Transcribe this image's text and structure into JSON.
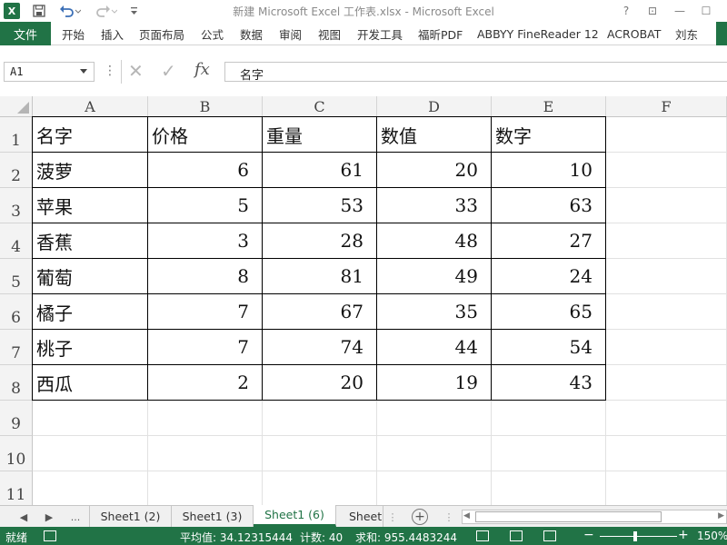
{
  "window": {
    "title": "新建 Microsoft Excel 工作表.xlsx - Microsoft Excel",
    "app_icon": "X",
    "help": "?",
    "restore_ribbon": "⊡",
    "minimize": "—",
    "maximize": "☐"
  },
  "quick_access": {
    "save_icon": "save-icon",
    "undo_icon": "undo-icon",
    "redo_icon": "redo-icon",
    "customize": "customize-icon"
  },
  "ribbon": {
    "file": "文件",
    "tabs": [
      "开始",
      "插入",
      "页面布局",
      "公式",
      "数据",
      "审阅",
      "视图",
      "开发工具",
      "福昕PDF",
      "ABBYY FineReader 12",
      "ACROBAT",
      "刘东"
    ]
  },
  "formula_bar": {
    "name_box": "A1",
    "dots": "⋮",
    "cancel": "✕",
    "enter": "✓",
    "fx": "fx",
    "content": "名字"
  },
  "columns": [
    "A",
    "B",
    "C",
    "D",
    "E",
    "F"
  ],
  "rows": [
    "1",
    "2",
    "3",
    "4",
    "5",
    "6",
    "7",
    "8",
    "9",
    "10",
    "11"
  ],
  "table": {
    "headers": [
      "名字",
      "价格",
      "重量",
      "数值",
      "数字"
    ],
    "data": [
      [
        "菠萝",
        "6",
        "61",
        "20",
        "10"
      ],
      [
        "苹果",
        "5",
        "53",
        "33",
        "63"
      ],
      [
        "香蕉",
        "3",
        "28",
        "48",
        "27"
      ],
      [
        "葡萄",
        "8",
        "81",
        "49",
        "24"
      ],
      [
        "橘子",
        "7",
        "67",
        "35",
        "65"
      ],
      [
        "桃子",
        "7",
        "74",
        "44",
        "54"
      ],
      [
        "西瓜",
        "2",
        "20",
        "19",
        "43"
      ]
    ]
  },
  "sheets": {
    "nav_prev": "◀",
    "nav_next": "▶",
    "ellipsis": "...",
    "tabs": [
      "Sheet1 (2)",
      "Sheet1 (3)",
      "Sheet1 (6)",
      "Sheet"
    ],
    "active": "Sheet1 (6)",
    "add": "+"
  },
  "status": {
    "ready": "就绪",
    "average": "平均值: 34.12315444",
    "count": "计数: 40",
    "sum": "求和: 955.4483244",
    "zoom_minus": "−",
    "zoom_plus": "+",
    "zoom": "150%"
  },
  "colors": {
    "accent": "#217346"
  }
}
